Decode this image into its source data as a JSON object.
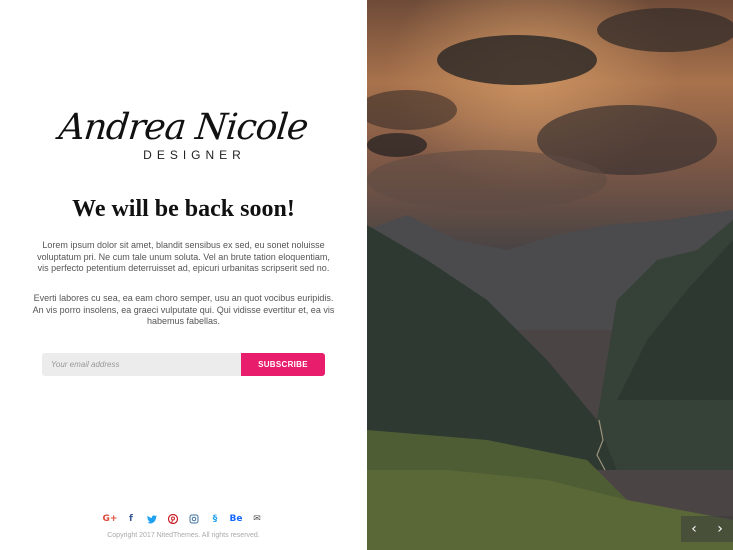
{
  "logo": {
    "script": "Andrea Nicole",
    "subtitle": "DESIGNER"
  },
  "headline": "We will be back soon!",
  "paragraphs": [
    "Lorem ipsum dolor sit amet, blandit sensibus ex sed, eu sonet noluisse voluptatum pri. Ne cum tale unum soluta. Vel an brute tation eloquentiam, vis perfecto petentium deterruisset ad, epicuri urbanitas scripserit sed no.",
    "Everti labores cu sea, ea eam choro semper, usu an quot vocibus euripidis. An vis porro insolens, ea graeci vulputate qui. Qui vidisse evertitur et, ea vis habemus fabellas."
  ],
  "subscribe": {
    "placeholder": "Your email address",
    "button": "SUBSCRIBE"
  },
  "social": [
    {
      "icon": "google-plus-icon",
      "glyph": "G+",
      "color": "#dd4b39"
    },
    {
      "icon": "facebook-icon",
      "glyph": "f",
      "color": "#3b5998"
    },
    {
      "icon": "twitter-icon",
      "glyph": "🐦",
      "color": "#1da1f2"
    },
    {
      "icon": "pinterest-icon",
      "glyph": "P",
      "color": "#cb2027"
    },
    {
      "icon": "instagram-icon",
      "glyph": "◎",
      "color": "#3f729b"
    },
    {
      "icon": "dribbble-icon",
      "glyph": "§",
      "color": "#1da1f2"
    },
    {
      "icon": "behance-icon",
      "glyph": "Be",
      "color": "#1769ff"
    },
    {
      "icon": "mail-icon",
      "glyph": "✉",
      "color": "#555555"
    }
  ],
  "copyright": "Copyright 2017 NitedThemes. All rights reserved.",
  "slider": {
    "prev": "‹",
    "next": "›"
  },
  "colors": {
    "accent": "#e81d6b"
  }
}
